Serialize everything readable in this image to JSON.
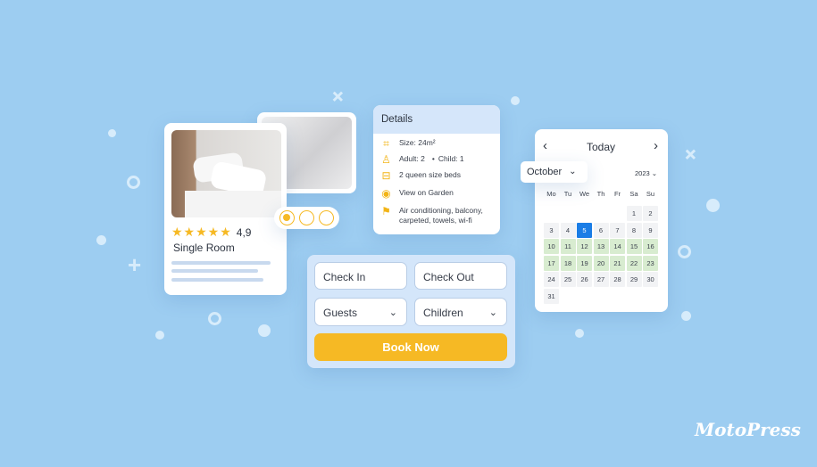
{
  "brand": {
    "logo_text": "MotoPress"
  },
  "room_card": {
    "rating": "4,9",
    "stars": 5,
    "title": "Single Room",
    "gallery_dots": 3,
    "active_dot": 1
  },
  "details": {
    "title": "Details",
    "items": [
      {
        "icon": "size-icon",
        "text": "Size: 24m²"
      },
      {
        "icon": "person-icon",
        "text": "Adult: 2",
        "extra": "Child: 1"
      },
      {
        "icon": "bed-icon",
        "text": "2 queen size beds"
      },
      {
        "icon": "eye-icon",
        "text": "View on Garden"
      },
      {
        "icon": "bookmark-icon",
        "text": "Air conditioning, balcony, carpeted, towels, wi-fi"
      }
    ]
  },
  "booking": {
    "check_in": "Check In",
    "check_out": "Check Out",
    "guests": "Guests",
    "children": "Children",
    "book_now": "Book Now"
  },
  "calendar": {
    "today_label": "Today",
    "prev": "‹",
    "next": "›",
    "month": "October",
    "year": "2023",
    "weekdays": [
      "Mo",
      "Tu",
      "We",
      "Th",
      "Fr",
      "Sa",
      "Su"
    ],
    "first_weekday_index": 5,
    "days_in_month": 31,
    "selected_day": 5,
    "available_days": [
      10,
      11,
      12,
      13,
      14,
      15,
      16,
      17,
      18,
      19,
      20,
      21,
      22,
      23
    ],
    "colors": {
      "available": "#d8ecd0",
      "selected": "#1a7de6",
      "default": "#f2f3f5"
    }
  },
  "colors": {
    "background": "#9dcdf1",
    "accent": "#f6b924",
    "form_bg": "#d4e6fa"
  }
}
